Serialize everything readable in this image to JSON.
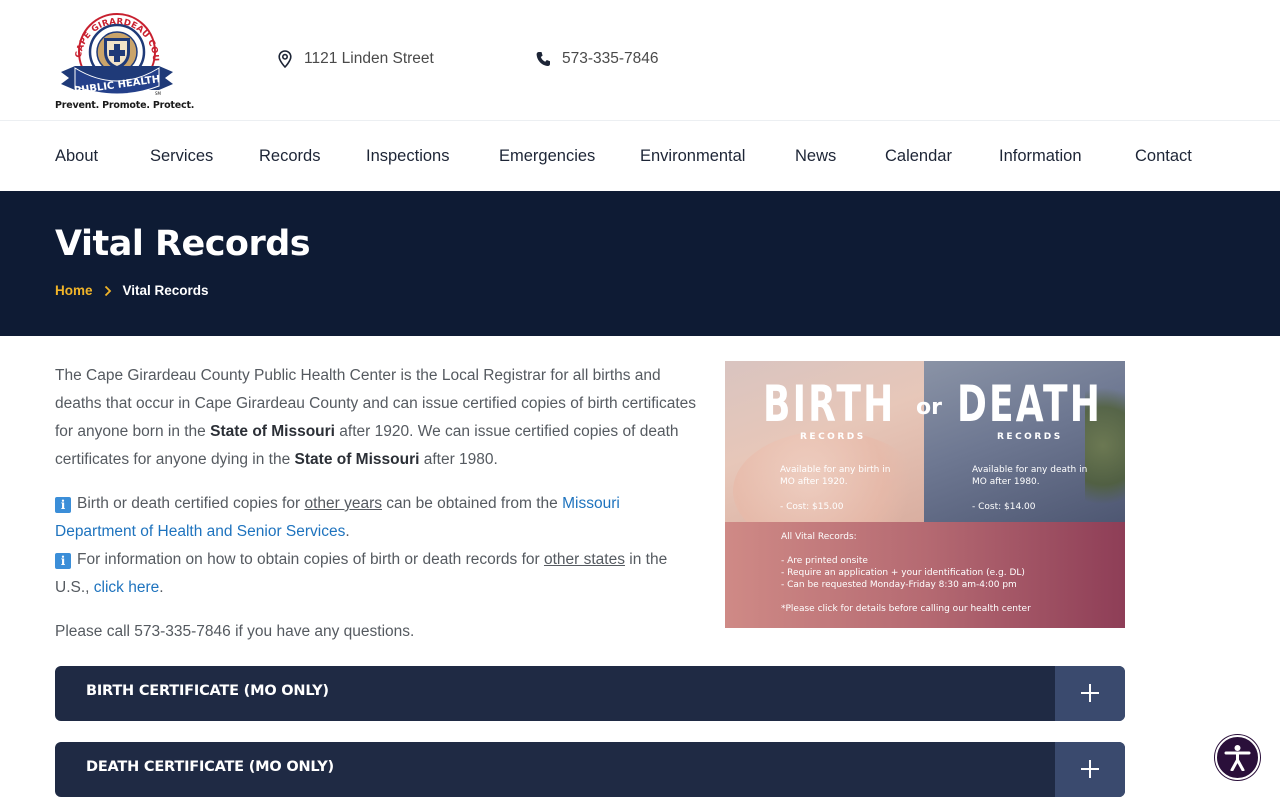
{
  "header": {
    "logo": {
      "arc_text": "CAPE GIRARDEAU COUNTY",
      "banner_text": "PUBLIC HEALTH",
      "sm": "SM",
      "tagline": "Prevent. Promote. Protect."
    },
    "address": "1121 Linden Street",
    "phone": "573-335-7846"
  },
  "nav": {
    "items": [
      "About",
      "Services",
      "Records",
      "Inspections",
      "Emergencies",
      "Environmental",
      "News",
      "Calendar",
      "Information",
      "Contact"
    ]
  },
  "hero": {
    "title": "Vital Records",
    "breadcrumb": {
      "home": "Home",
      "current": "Vital Records"
    }
  },
  "content": {
    "intro_1": "The Cape Girardeau County Public Health Center is the Local Registrar for all births and deaths that occur in Cape Girardeau County and can issue certified copies of birth certificates for anyone born in the ",
    "intro_bold_1": "State of Missouri",
    "intro_2": " after 1920. We can issue certified copies of death certificates for anyone dying in the ",
    "intro_bold_2": "State of Missouri",
    "intro_3": " after 1980.",
    "info_icon": "ℹ️",
    "note1_a": "Birth or death certified copies for ",
    "note1_u": "other years",
    "note1_b": " can be obtained from the ",
    "note1_link": "Missouri Department of Health and Senior Services",
    "note1_end": ".",
    "note2_a": "For information on how to obtain copies of birth or death records for ",
    "note2_u": "other states",
    "note2_b": " in the U.S., ",
    "note2_link": "click here",
    "note2_end": ".",
    "call": "Please call 573-335-7846 if you have any questions."
  },
  "promo": {
    "birth": "BIRTH",
    "or": "or",
    "death": "DEATH",
    "records_left": "RECORDS",
    "records_right": "RECORDS",
    "birth_line1": "Available for any birth in",
    "birth_line2": "MO after 1920.",
    "birth_cost": "- Cost: $15.00",
    "death_line1": "Available for any death in",
    "death_line2": "MO after 1980.",
    "death_cost": "- Cost: $14.00",
    "all_title": "All Vital Records:",
    "all_1": "- Are printed onsite",
    "all_2": "- Require an application + your identification (e.g. DL)",
    "all_3": "- Can be requested Monday-Friday 8:30 am-4:00 pm",
    "all_note": "*Please click for details before calling our health center"
  },
  "accordions": [
    {
      "title": "BIRTH CERTIFICATE (MO ONLY)"
    },
    {
      "title": "DEATH CERTIFICATE (MO ONLY)"
    }
  ],
  "colors": {
    "navy": "#0e1b34",
    "accordion": "#1f2a44",
    "accordion_toggle": "#3a4a6e",
    "accent_gold": "#f0b429",
    "link_blue": "#1e73be"
  }
}
